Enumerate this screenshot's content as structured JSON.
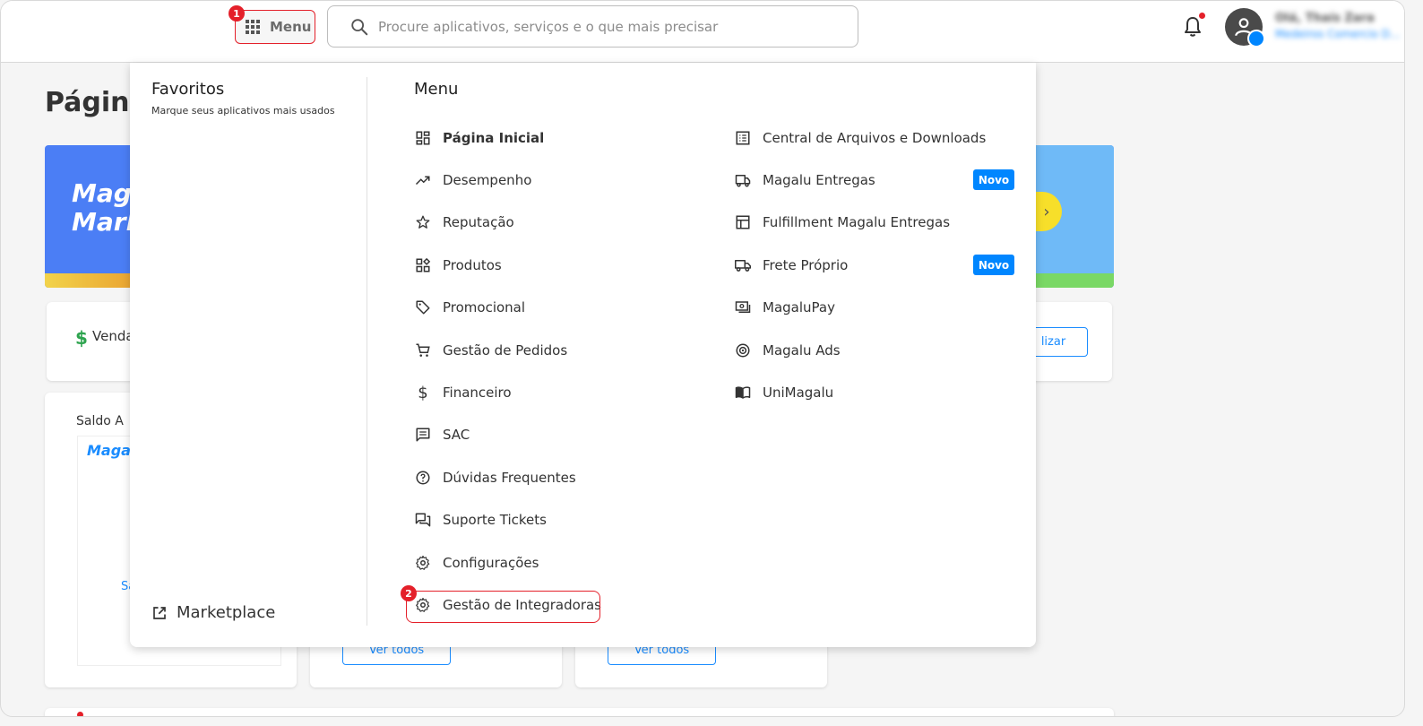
{
  "header": {
    "menu_label": "Menu",
    "step1": "1",
    "search_placeholder": "Procure aplicativos, serviços e o que mais precisar",
    "user_name": "Olá, Thaís Zara",
    "user_company": "Medeiros Comercio D..."
  },
  "background": {
    "page_title": "Página",
    "banner_logo_top": "Magalu",
    "banner_logo_bottom": "Mark",
    "sales_label": "Venda",
    "update_button": "lizar",
    "balance_label": "Saldo A",
    "magalu_small": "Magal",
    "see_link": "Sa",
    "see_all_1": "Ver todos",
    "see_all_2": "Ver todos"
  },
  "favorites": {
    "title": "Favoritos",
    "subtitle": "Marque seus aplicativos mais usados",
    "marketplace_label": "Marketplace"
  },
  "menu": {
    "title": "Menu",
    "step2": "2",
    "left_items": [
      {
        "label": "Página Inicial",
        "icon": "dashboard-icon"
      },
      {
        "label": "Desempenho",
        "icon": "trending-up-icon"
      },
      {
        "label": "Reputação",
        "icon": "star-icon"
      },
      {
        "label": "Produtos",
        "icon": "products-icon"
      },
      {
        "label": "Promocional",
        "icon": "tag-icon"
      },
      {
        "label": "Gestão de Pedidos",
        "icon": "cart-icon"
      },
      {
        "label": "Financeiro",
        "icon": "dollar-icon"
      },
      {
        "label": "SAC",
        "icon": "message-icon"
      },
      {
        "label": "Dúvidas Frequentes",
        "icon": "help-icon"
      },
      {
        "label": "Suporte Tickets",
        "icon": "forum-icon"
      },
      {
        "label": "Configurações",
        "icon": "gear-icon"
      },
      {
        "label": "Gestão de Integradoras",
        "icon": "gear-icon"
      }
    ],
    "right_items": [
      {
        "label": "Central de Arquivos e Downloads",
        "icon": "list-icon"
      },
      {
        "label": "Magalu Entregas",
        "icon": "delivery-icon",
        "badge": "Novo"
      },
      {
        "label": "Fulfillment Magalu Entregas",
        "icon": "warehouse-icon"
      },
      {
        "label": "Frete Próprio",
        "icon": "truck-icon",
        "badge": "Novo"
      },
      {
        "label": "MagaluPay",
        "icon": "pay-icon"
      },
      {
        "label": "Magalu Ads",
        "icon": "target-icon"
      },
      {
        "label": "UniMagalu",
        "icon": "book-icon"
      }
    ]
  },
  "colors": {
    "accent_red": "#e4202a",
    "brand_blue": "#0086ff",
    "banner_blue": "#4b7ef5"
  }
}
